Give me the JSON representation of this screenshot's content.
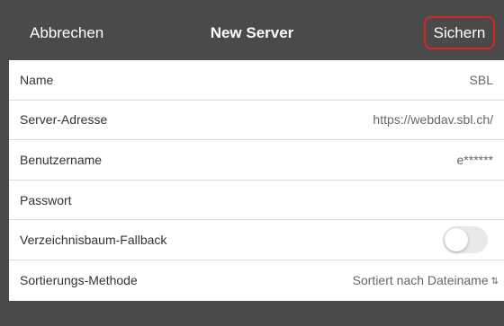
{
  "navbar": {
    "cancel_label": "Abbrechen",
    "title": "New Server",
    "save_label": "Sichern",
    "highlight_color": "#d6281f",
    "background_color": "#4a4a4a"
  },
  "form": {
    "rows": [
      {
        "label": "Name",
        "value": "SBL"
      },
      {
        "label": "Server-Adresse",
        "value": "https://webdav.sbl.ch/"
      },
      {
        "label": "Benutzername",
        "value": "e******"
      },
      {
        "label": "Passwort",
        "value": ""
      },
      {
        "label": "Verzeichnisbaum-Fallback",
        "toggle_on": false
      },
      {
        "label": "Sortierungs-Methode",
        "value": "Sortiert nach Dateiname",
        "sort_icon": "sort-arrows-icon"
      }
    ]
  }
}
